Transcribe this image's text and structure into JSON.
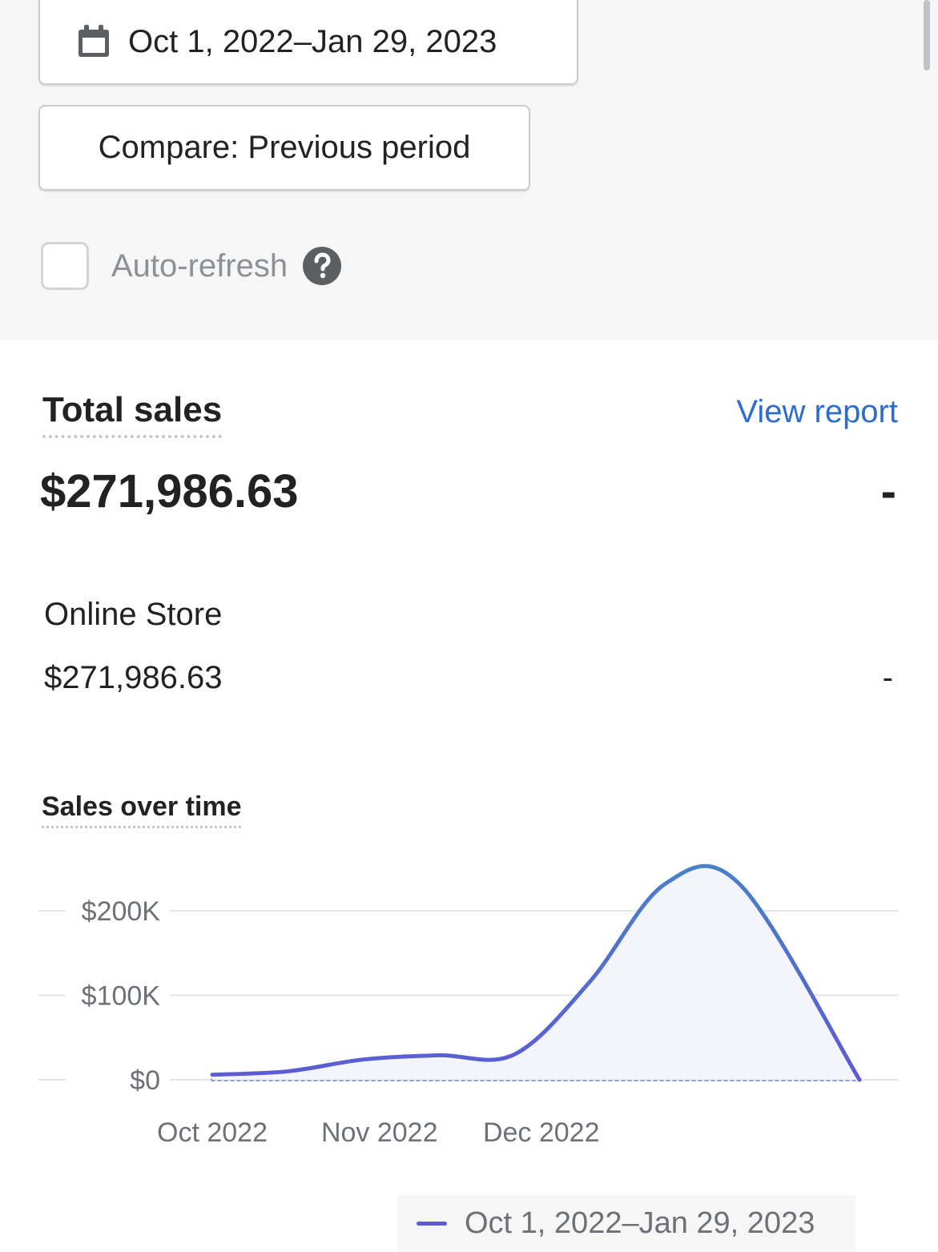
{
  "filters": {
    "date_range_label": "Oct 1, 2022–Jan 29, 2023",
    "compare_label": "Compare: Previous period",
    "auto_refresh_label": "Auto-refresh",
    "auto_refresh_checked": false
  },
  "total_sales": {
    "title": "Total sales",
    "view_report_label": "View report",
    "value": "$271,986.63",
    "change": "-"
  },
  "breakdown": [
    {
      "channel": "Online Store",
      "value": "$271,986.63",
      "change": "-"
    }
  ],
  "sales_over_time": {
    "title": "Sales over time"
  },
  "chart_data": {
    "type": "line",
    "title": "Sales over time",
    "x_tick_labels": [
      "Oct 2022",
      "Nov 2022",
      "Dec 2022"
    ],
    "y_tick_labels": [
      "$0",
      "$100K",
      "$200K"
    ],
    "ylim": [
      0,
      200000
    ],
    "grid": true,
    "legend": "bottom-right",
    "series": [
      {
        "name": "Oct 1, 2022–Jan 29, 2023",
        "color": "#5c5bd4",
        "x": [
          "2022-10-01",
          "2022-10-15",
          "2022-10-29",
          "2022-11-12",
          "2022-11-26",
          "2022-12-10",
          "2022-12-24",
          "2023-01-07",
          "2023-01-29"
        ],
        "values": [
          6000,
          10000,
          24000,
          29000,
          30000,
          116000,
          232000,
          230000,
          0
        ]
      },
      {
        "name": "Previous period",
        "style": "dotted",
        "color": "#8ba3d9",
        "x": [
          "2022-10-01",
          "2023-01-29"
        ],
        "values": [
          0,
          0
        ]
      }
    ]
  }
}
